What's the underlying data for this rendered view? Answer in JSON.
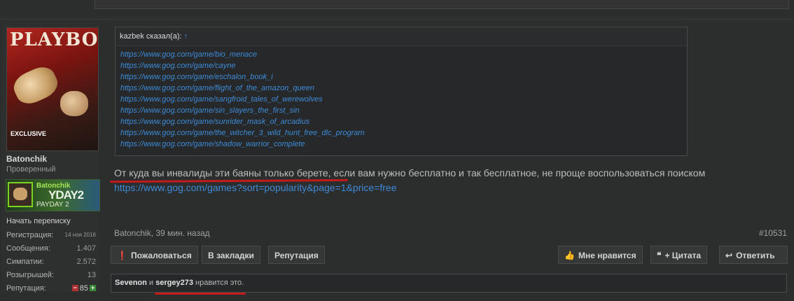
{
  "user": {
    "name": "Batonchik",
    "title": "Проверенный",
    "avatar_caption": "EXCLUSIVE",
    "avatar_logo": "PLAYBOY",
    "steam": {
      "name": "Batonchik",
      "game": "PAYDAY 2",
      "banner": "YDAY2"
    },
    "pm_link": "Начать переписку",
    "stats": [
      {
        "label": "Регистрация:",
        "value": "14 ноя 2016"
      },
      {
        "label": "Сообщения:",
        "value": "1.407"
      },
      {
        "label": "Симпатии:",
        "value": "2.572"
      },
      {
        "label": "Розыгрышей:",
        "value": "13"
      }
    ],
    "reputation": {
      "label": "Репутация:",
      "value": "85"
    }
  },
  "quote": {
    "author_line": "kazbek сказал(а):",
    "arrow": "↑",
    "links": [
      "https://www.gog.com/game/bio_menace",
      "https://www.gog.com/game/cayne",
      "https://www.gog.com/game/eschalon_book_i",
      "https://www.gog.com/game/flight_of_the_amazon_queen",
      "https://www.gog.com/game/sangfroid_tales_of_werewolves",
      "https://www.gog.com/game/sin_slayers_the_first_sin",
      "https://www.gog.com/game/sunrider_mask_of_arcadius",
      "https://www.gog.com/game/the_witcher_3_wild_hunt_free_dlc_program",
      "https://www.gog.com/game/shadow_warrior_complete"
    ]
  },
  "message": {
    "text": "От куда вы инвалиды эти баяны только берете, если вам нужно бесплатно и так бесплатное, не проще воспользоваться поиском",
    "link": "https://www.gog.com/games?sort=popularity&page=1&price=free"
  },
  "meta": {
    "author_time": "Batonchik, 39 мин. назад",
    "post_number": "#10531"
  },
  "actions": {
    "report": "Пожаловаться",
    "bookmark": "В закладки",
    "reputation": "Репутация",
    "like": "Мне нравится",
    "quote": "+ Цитата",
    "reply": "Ответить"
  },
  "likes": {
    "user1": "Sevenon",
    "and": "и",
    "user2": "sergey273",
    "suffix": "нравится это."
  },
  "colors": {
    "accent_link": "#3e8bd8",
    "highlight_underline": "#c11b1b",
    "steam_green": "#7ed321"
  }
}
